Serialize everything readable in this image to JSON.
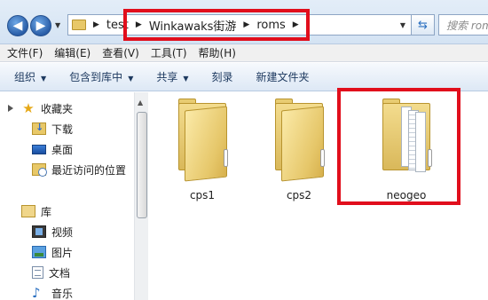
{
  "address": {
    "breadcrumbs": [
      "test",
      "Winkawaks街游",
      "roms"
    ],
    "search_placeholder": "搜索 roms"
  },
  "menu": [
    "文件(F)",
    "编辑(E)",
    "查看(V)",
    "工具(T)",
    "帮助(H)"
  ],
  "toolbar": [
    {
      "label": "组织",
      "dropdown": true
    },
    {
      "label": "包含到库中",
      "dropdown": true
    },
    {
      "label": "共享",
      "dropdown": true
    },
    {
      "label": "刻录",
      "dropdown": false
    },
    {
      "label": "新建文件夹",
      "dropdown": false
    }
  ],
  "nav": {
    "favorites": {
      "label": "收藏夹",
      "icon": "star-icon"
    },
    "favorites_items": [
      {
        "label": "下载",
        "icon": "downloads-icon"
      },
      {
        "label": "桌面",
        "icon": "desktop-icon"
      },
      {
        "label": "最近访问的位置",
        "icon": "recent-places-icon"
      }
    ],
    "libraries": {
      "label": "库",
      "icon": "library-icon"
    },
    "libraries_items": [
      {
        "label": "视频",
        "icon": "video-icon"
      },
      {
        "label": "图片",
        "icon": "pictures-icon"
      },
      {
        "label": "文档",
        "icon": "documents-icon"
      },
      {
        "label": "音乐",
        "icon": "music-icon"
      }
    ]
  },
  "folders": [
    {
      "name": "cps1",
      "icon": "folder-icon"
    },
    {
      "name": "cps2",
      "icon": "folder-icon"
    },
    {
      "name": "neogeo",
      "icon": "folder-with-documents-icon"
    }
  ],
  "highlight_color": "#e10e1c"
}
